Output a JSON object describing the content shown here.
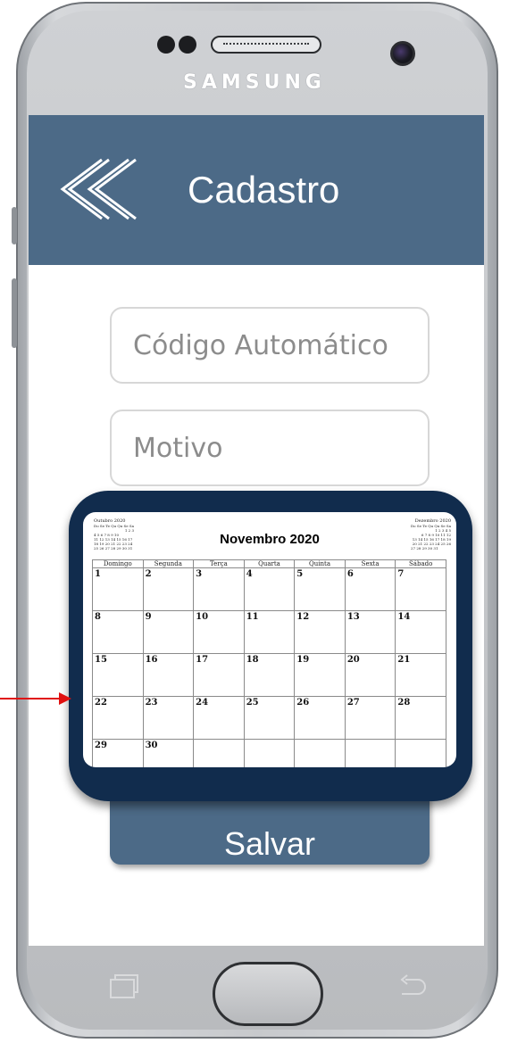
{
  "device": {
    "brand": "SAMSUNG"
  },
  "header": {
    "title": "Cadastro",
    "back_icon": "double-chevron-left-icon"
  },
  "form": {
    "code_placeholder": "Código Automático",
    "reason_placeholder": "Motivo",
    "save_label": "Salvar"
  },
  "calendar": {
    "title": "Novembro 2020",
    "weekdays": [
      "Domingo",
      "Segunda",
      "Terça",
      "Quarta",
      "Quinta",
      "Sexta",
      "Sábado"
    ],
    "weeks": [
      [
        "1",
        "2",
        "3",
        "4",
        "5",
        "6",
        "7"
      ],
      [
        "8",
        "9",
        "10",
        "11",
        "12",
        "13",
        "14"
      ],
      [
        "15",
        "16",
        "17",
        "18",
        "19",
        "20",
        "21"
      ],
      [
        "22",
        "23",
        "24",
        "25",
        "26",
        "27",
        "28"
      ],
      [
        "29",
        "30",
        "",
        "",
        "",
        "",
        ""
      ]
    ],
    "prev_month": {
      "title": "Outubro 2020",
      "header": "Do Se Te Qu Qu Se Sa",
      "rows": [
        "1 2 3",
        "4 5 6 7 8 9 10",
        "11 12 13 14 15 16 17",
        "18 19 20 21 22 23 24",
        "25 26 27 28 29 30 31"
      ]
    },
    "next_month": {
      "title": "Dezembro 2020",
      "header": "Do Se Te Qu Qu Se Sa",
      "rows": [
        "1 2 3 4 5",
        "6 7 8 9 10 11 12",
        "13 14 15 16 17 18 19",
        "20 21 22 23 24 25 26",
        "27 28 29 30 31"
      ]
    }
  },
  "colors": {
    "primary": "#4c6a87",
    "popup_frame": "#112c4d",
    "annotation_arrow": "#e01010"
  }
}
